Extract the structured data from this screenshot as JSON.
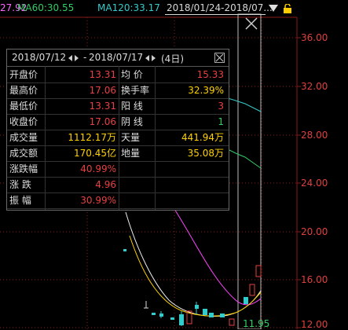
{
  "topbar": {
    "ma_partial": "27.92",
    "ma60": "MA60:30.55",
    "ma120": "MA120:33.17",
    "range": "2018/01/24-2018/07..."
  },
  "axis": [
    "36.00",
    "32.00",
    "28.00",
    "24.00",
    "20.00",
    "16.00",
    "12.00"
  ],
  "bottom": {
    "low_price": "11.95",
    "tail": "1"
  },
  "panel": {
    "date_from": "2018/07/12",
    "date_to": "2018/07/17",
    "days": "(4日)",
    "rows": [
      {
        "l1": "开盘价",
        "v1": "13.31",
        "c1": "red",
        "l2": "均 价",
        "v2": "15.33",
        "c2": "red"
      },
      {
        "l1": "最高价",
        "v1": "17.06",
        "c1": "red",
        "l2": "换手率",
        "v2": "32.39%",
        "c2": "yellow"
      },
      {
        "l1": "最低价",
        "v1": "13.31",
        "c1": "red",
        "l2": "阳 线",
        "v2": "3",
        "c2": "red"
      },
      {
        "l1": "收盘价",
        "v1": "17.06",
        "c1": "red",
        "l2": "阴 线",
        "v2": "1",
        "c2": "green"
      },
      {
        "l1": "成交量",
        "v1": "1112.17万",
        "c1": "yellow",
        "l2": "天量",
        "v2": "441.94万",
        "c2": "yellow"
      },
      {
        "l1": "成交额",
        "v1": "170.45亿",
        "c1": "yellow",
        "l2": "地量",
        "v2": "35.08万",
        "c2": "yellow"
      },
      {
        "l1": "涨跌幅",
        "v1": "40.99%",
        "c1": "red",
        "l2": "",
        "v2": "",
        "c2": "white"
      },
      {
        "l1": "涨 跌",
        "v1": "4.96",
        "c1": "red",
        "l2": "",
        "v2": "",
        "c2": "white"
      },
      {
        "l1": "振 幅",
        "v1": "30.99%",
        "c1": "red",
        "l2": "",
        "v2": "",
        "c2": "white"
      }
    ]
  }
}
